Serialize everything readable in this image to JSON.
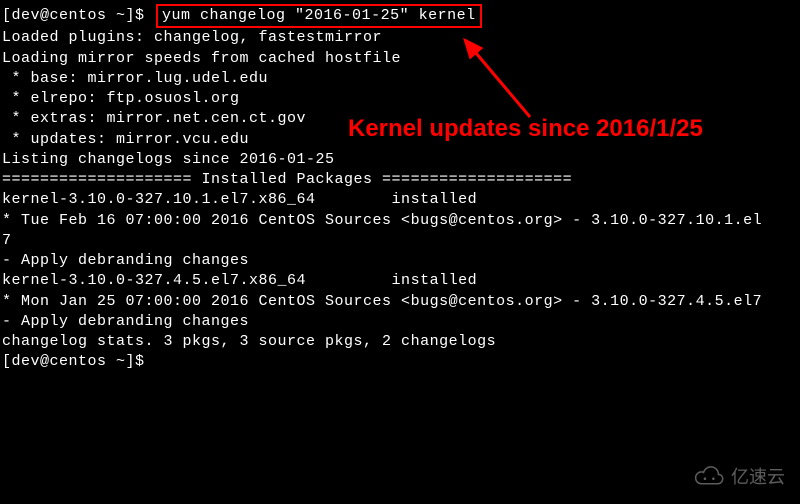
{
  "prompt": "[dev@centos ~]$ ",
  "command": "yum changelog \"2016-01-25\" kernel",
  "output": {
    "l1": "Loaded plugins: changelog, fastestmirror",
    "l2": "Loading mirror speeds from cached hostfile",
    "l3": " * base: mirror.lug.udel.edu",
    "l4": " * elrepo: ftp.osuosl.org",
    "l5": " * extras: mirror.net.cen.ct.gov",
    "l6": " * updates: mirror.vcu.edu",
    "l7": "",
    "l8": "Listing changelogs since 2016-01-25",
    "l9": "",
    "l10": "==================== Installed Packages ====================",
    "l11": "kernel-3.10.0-327.10.1.el7.x86_64        installed",
    "l12": "* Tue Feb 16 07:00:00 2016 CentOS Sources <bugs@centos.org> - 3.10.0-327.10.1.el",
    "l13": "7",
    "l14": "- Apply debranding changes",
    "l15": "",
    "l16": "",
    "l17": "kernel-3.10.0-327.4.5.el7.x86_64         installed",
    "l18": "* Mon Jan 25 07:00:00 2016 CentOS Sources <bugs@centos.org> - 3.10.0-327.4.5.el7",
    "l19": "- Apply debranding changes",
    "l20": "",
    "l21": "changelog stats. 3 pkgs, 3 source pkgs, 2 changelogs"
  },
  "prompt2": "[dev@centos ~]$",
  "annotation": "Kernel updates since 2016/1/25",
  "watermark": "亿速云"
}
